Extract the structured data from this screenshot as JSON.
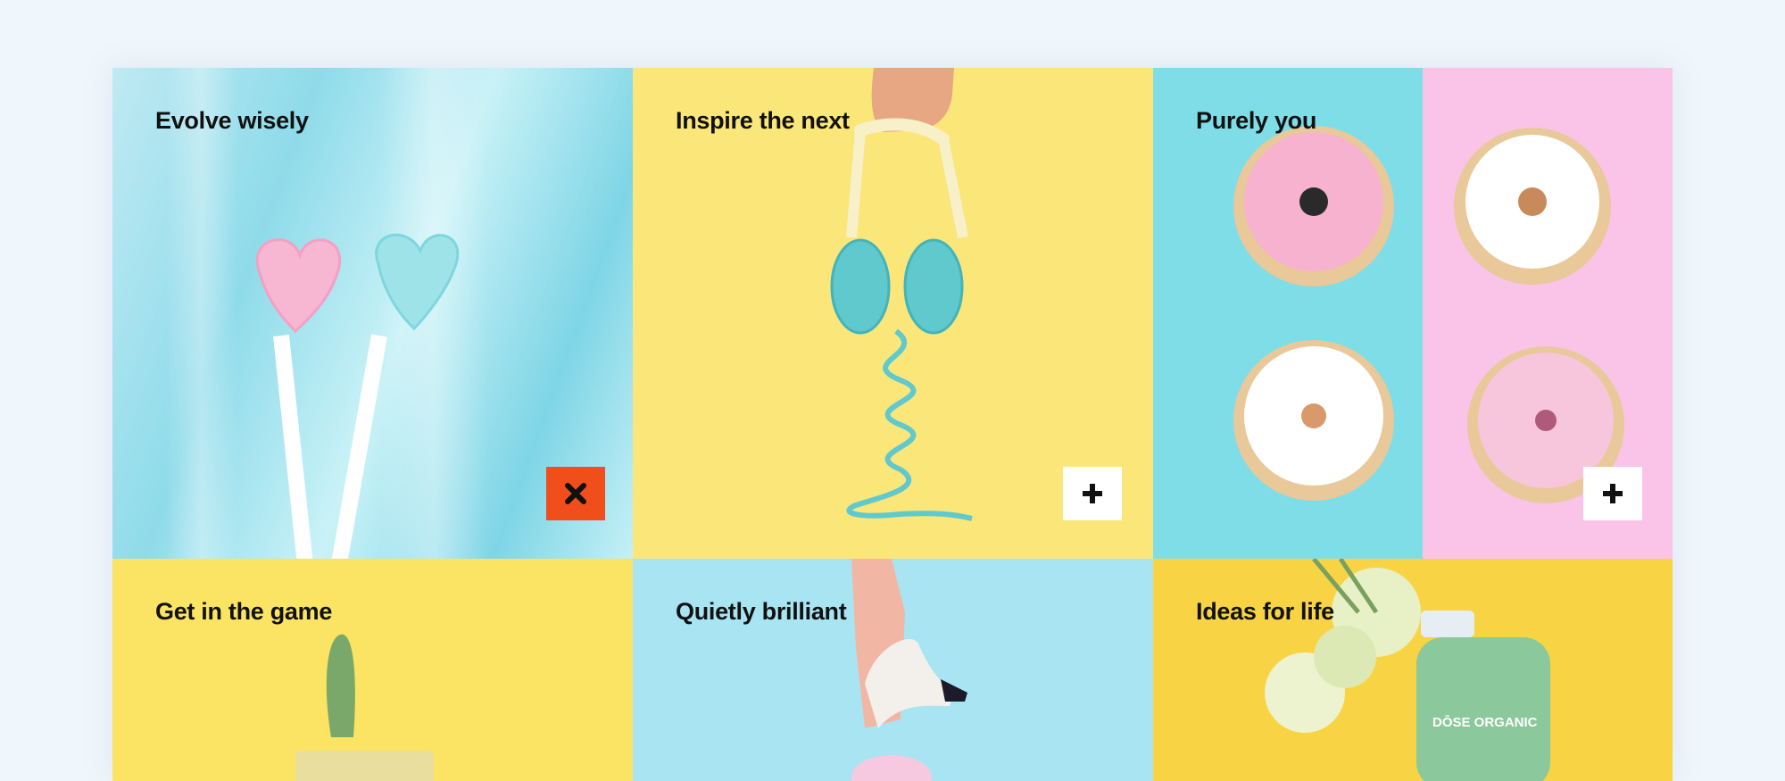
{
  "tiles": [
    {
      "title": "Evolve wisely",
      "bg": "#c6eef5",
      "toggle": "close",
      "toggle_icon": "close-icon"
    },
    {
      "title": "Inspire the next",
      "bg": "#fbe67a",
      "toggle": "plus",
      "toggle_icon": "plus-icon"
    },
    {
      "title": "Purely you",
      "bg_left": "#7fdde8",
      "bg_right": "#f9c4e8",
      "toggle": "plus",
      "toggle_icon": "plus-icon"
    },
    {
      "title": "Get in the game",
      "bg": "#fbe463"
    },
    {
      "title": "Quietly brilliant",
      "bg": "#a8e4f2"
    },
    {
      "title": "Ideas for life",
      "bg": "#f8d444",
      "bottle_label": "DŌSE ORGANIC"
    }
  ],
  "colors": {
    "page_bg": "#eff6fc",
    "close_accent": "#f04f1c"
  }
}
